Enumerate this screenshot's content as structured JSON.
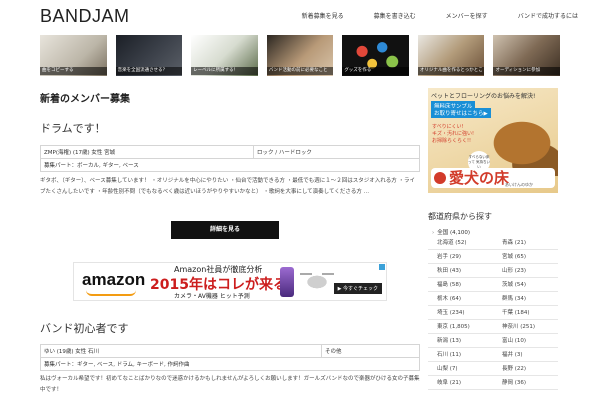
{
  "site": {
    "logo": "BANDJAM"
  },
  "nav": [
    {
      "label": "新着募集を見る"
    },
    {
      "label": "募集を書き込む"
    },
    {
      "label": "メンバーを探す"
    },
    {
      "label": "バンドで成功するには"
    }
  ],
  "thumbnails": [
    {
      "caption": "曲をコピーする"
    },
    {
      "caption": "音楽を全国流通させる？"
    },
    {
      "caption": "レーベルに所属する！"
    },
    {
      "caption": "バンド活動の前に必要なこと"
    },
    {
      "caption": "グッズを作る"
    },
    {
      "caption": "オリジナル曲を作るとっかとこ"
    },
    {
      "caption": "オーディションに参加"
    }
  ],
  "main": {
    "section_title": "新着のメンバー募集",
    "posts": [
      {
        "title": "ドラムです！",
        "info_left": "ZMP(海権) (17歳) 女性 宮城",
        "info_right": "ロック / ハードロック",
        "parts": "募集パート：ボーカル, ギター, ベース",
        "description": "ギタボ、（ギター）、ベース募集しています！ ・オリジナルを中心にやりたい ・仙台で活動できる方 ・最低でも週に１〜２回はスタジオ入れる方 ・ライブたくさんしたいです ・年齢性別不問（でもなるべく歳は近いほうがやりやすいかなと） ・歌詞を大事にして演奏してくださる方 …",
        "detail_button": "詳細を見る"
      },
      {
        "title": "バンド初心者です",
        "info_left": "ゆい (19歳) 女性 石川",
        "info_right": "その他",
        "parts": "募集パート：ギター, ベース, ドラム, キーボード, 作詞作曲",
        "description": "私はヴォーカル希望です！初めてなことばかりなので迷惑かけるかもしれませんがよろしくお願いします！ガールズバンドなので楽器がひける女の子募集中です！"
      }
    ]
  },
  "amazon_ad": {
    "logo": "amazon",
    "line1": "Amazon社員が徹底分析",
    "line2": "2015年はコレが来る",
    "line3": "カメラ・AV機器 ヒット予測",
    "cta": "▶ 今すぐチェック"
  },
  "sidebar_ad": {
    "headline": "ペットとフローリングのお悩みを解決!",
    "badge1": "無料床サンプル",
    "badge2": "お取り寄せはこちら▶",
    "copy": "すべりにくい!\nキズ・汚れに強い!\nお掃除らくらく!!",
    "bubble": "すべらない床って 気持ちいい",
    "brand": "愛犬の床",
    "brand_sub": "あいけんのゆか"
  },
  "prefectures": {
    "title": "都道府県から探す",
    "all": "全国 (4,100)",
    "items": [
      "北海道 (52)",
      "青森 (21)",
      "岩手 (29)",
      "宮城 (65)",
      "秋田 (43)",
      "山形 (23)",
      "福島 (58)",
      "茨城 (54)",
      "栃木 (64)",
      "群馬 (34)",
      "埼玉 (234)",
      "千葉 (184)",
      "東京 (1,805)",
      "神奈川 (251)",
      "新潟 (13)",
      "富山 (10)",
      "石川 (11)",
      "福井 (3)",
      "山梨 (7)",
      "長野 (22)",
      "岐阜 (21)",
      "静岡 (36)"
    ]
  }
}
